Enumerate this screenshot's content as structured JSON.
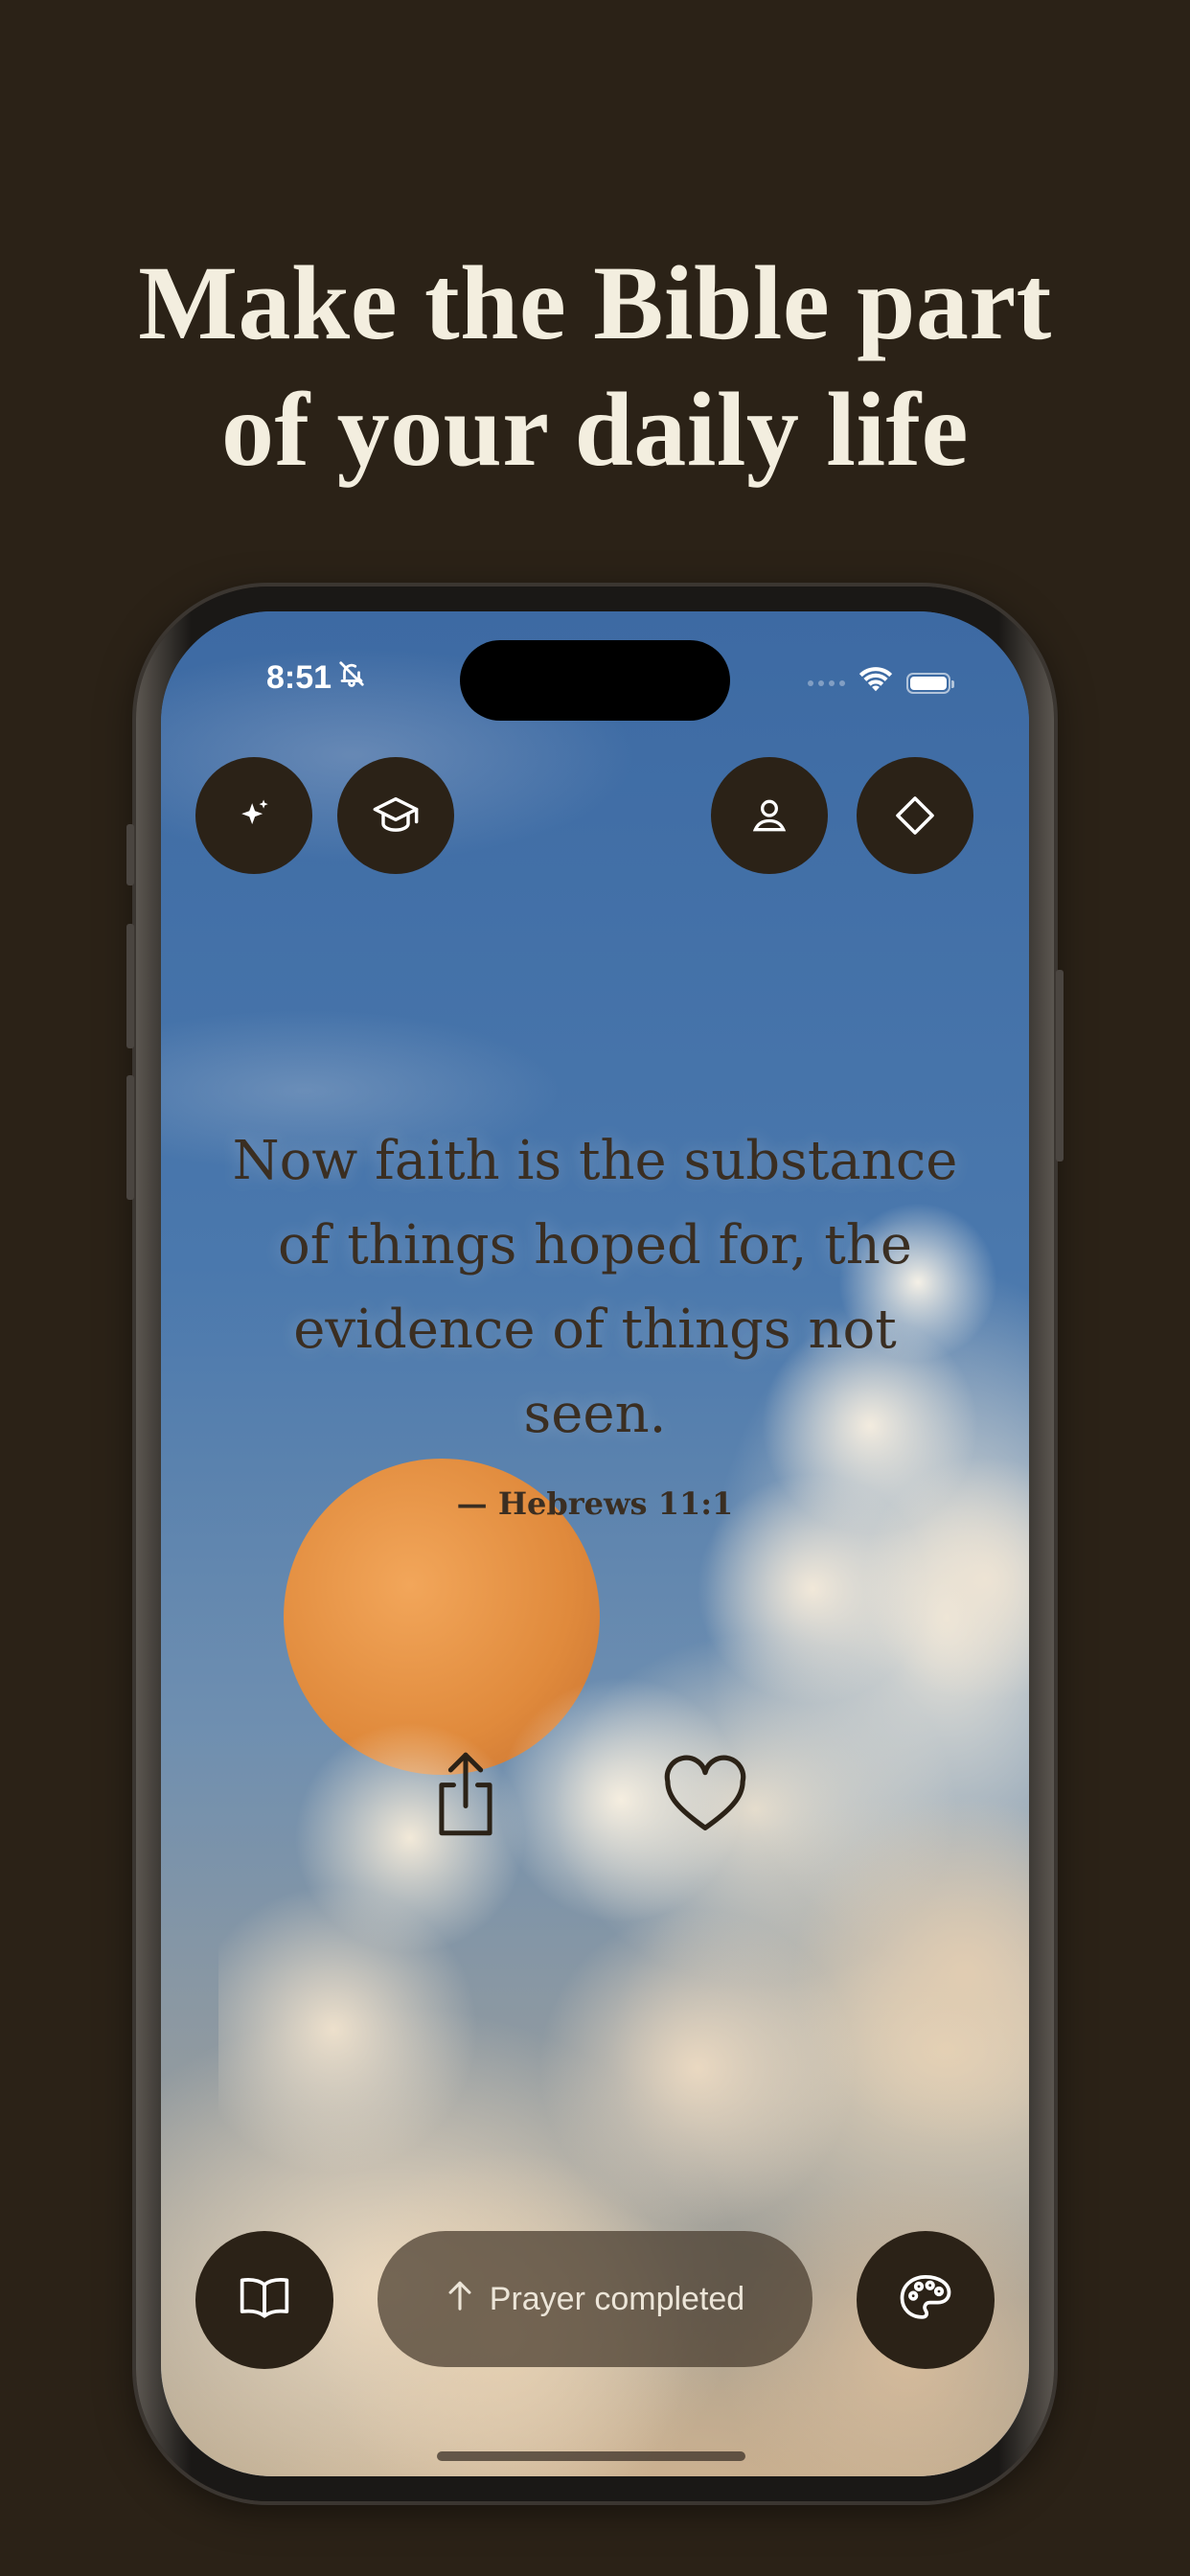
{
  "headline": {
    "line1": "Make the Bible part",
    "line2": "of your daily life"
  },
  "status_bar": {
    "time": "8:51",
    "icons": [
      "bell-slash-icon",
      "signal-icon",
      "wifi-icon",
      "battery-icon"
    ]
  },
  "top_buttons": {
    "left": [
      "sparkles-icon",
      "graduation-cap-icon"
    ],
    "right": [
      "person-icon",
      "diamond-icon"
    ]
  },
  "verse": {
    "lines": [
      "Now faith is the substance",
      "of things hoped for, the",
      "evidence of things not",
      "seen."
    ],
    "reference": "— Hebrews 11:1"
  },
  "actions": [
    "share-icon",
    "heart-icon"
  ],
  "bottom_bar": {
    "left_icon": "book-icon",
    "pill_label": "Prayer completed",
    "pill_icon": "arrow-up-icon",
    "right_icon": "palette-icon"
  },
  "colors": {
    "background": "#2b2217",
    "headline": "#f3eedf",
    "button": "#2b2217",
    "verse_text": "#3a2e22"
  }
}
